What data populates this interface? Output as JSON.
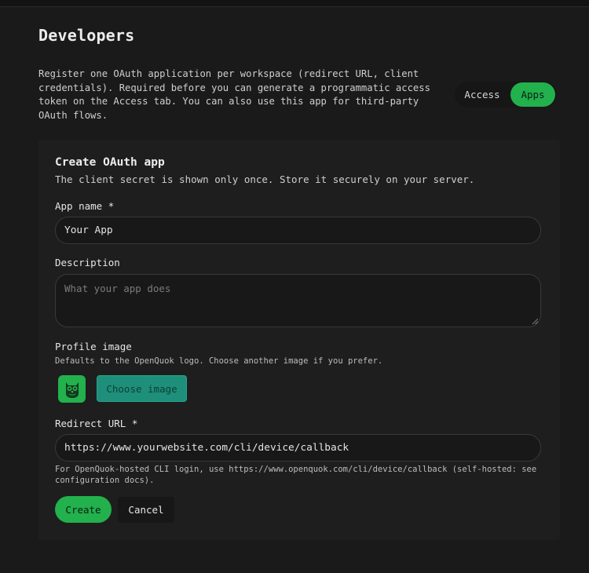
{
  "page": {
    "title": "Developers",
    "intro": "Register one OAuth application per workspace (redirect URL, client credentials). Required before you can generate a programmatic access token on the Access tab. You can also use this app for third-party OAuth flows."
  },
  "tabs": [
    {
      "label": "Access",
      "active": false
    },
    {
      "label": "Apps",
      "active": true
    }
  ],
  "form": {
    "title": "Create OAuth app",
    "subtitle": "The client secret is shown only once. Store it securely on your server.",
    "app_name": {
      "label": "App name *",
      "value": "Your App"
    },
    "description": {
      "label": "Description",
      "placeholder": "What your app does"
    },
    "profile_image": {
      "label": "Profile image",
      "help": "Defaults to the OpenQuok logo. Choose another image if you prefer.",
      "button": "Choose image",
      "avatar_icon": "owl-logo-icon"
    },
    "redirect_url": {
      "label": "Redirect URL *",
      "value": "https://www.yourwebsite.com/cli/device/callback",
      "help": "For OpenQuok-hosted CLI login, use https://www.openquok.com/cli/device/callback (self-hosted: see configuration docs)."
    },
    "create_label": "Create",
    "cancel_label": "Cancel"
  },
  "colors": {
    "accent": "#22b14c",
    "teal": "#1e8f7a",
    "background": "#1b1a1a",
    "card": "#1f1e1e"
  }
}
